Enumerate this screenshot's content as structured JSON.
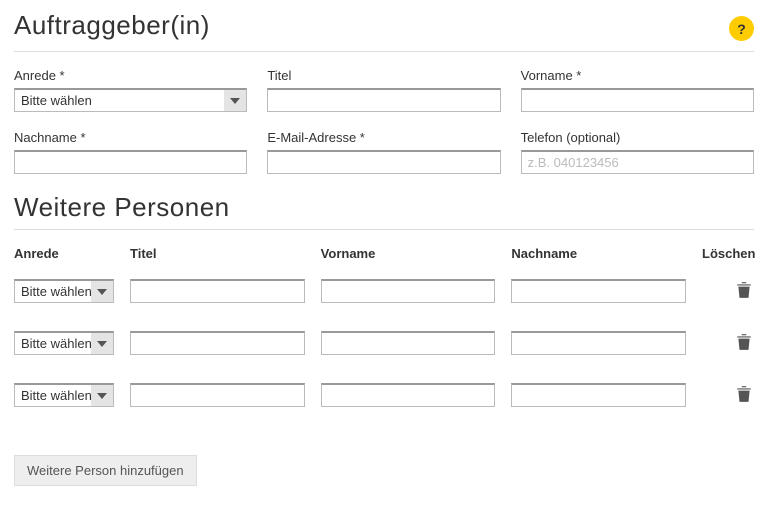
{
  "section1": {
    "title": "Auftraggeber(in)",
    "help_label": "?",
    "fields": {
      "anrede": {
        "label": "Anrede *",
        "value": "Bitte wählen"
      },
      "titel": {
        "label": "Titel",
        "value": ""
      },
      "vorname": {
        "label": "Vorname *",
        "value": ""
      },
      "nachname": {
        "label": "Nachname *",
        "value": ""
      },
      "email": {
        "label": "E-Mail-Adresse *",
        "value": ""
      },
      "telefon": {
        "label": "Telefon (optional)",
        "value": "",
        "placeholder": "z.B. 040123456"
      }
    }
  },
  "section2": {
    "title": "Weitere Personen",
    "columns": {
      "anrede": "Anrede",
      "titel": "Titel",
      "vorname": "Vorname",
      "nachname": "Nachname",
      "delete": "Löschen"
    },
    "rows": [
      {
        "anrede": "Bitte wählen",
        "titel": "",
        "vorname": "",
        "nachname": ""
      },
      {
        "anrede": "Bitte wählen",
        "titel": "",
        "vorname": "",
        "nachname": ""
      },
      {
        "anrede": "Bitte wählen",
        "titel": "",
        "vorname": "",
        "nachname": ""
      }
    ],
    "add_button": "Weitere Person hinzufügen"
  }
}
